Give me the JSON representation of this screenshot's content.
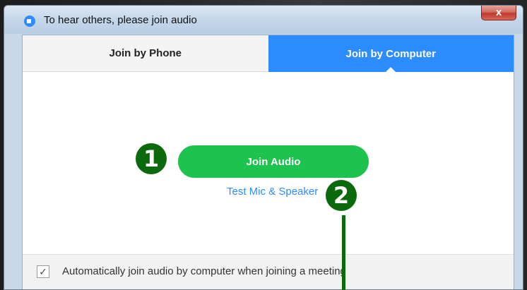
{
  "window": {
    "title": "To hear others, please join audio",
    "close_label": "x"
  },
  "tabs": [
    {
      "label": "Join by Phone",
      "active": false
    },
    {
      "label": "Join by Computer",
      "active": true
    }
  ],
  "main": {
    "join_audio_label": "Join Audio",
    "test_link_label": "Test Mic & Speaker"
  },
  "footer": {
    "checkbox_checked": true,
    "checkbox_glyph": "✓",
    "checkbox_label": "Automatically join audio by computer when joining a meeting"
  },
  "annotations": {
    "marker_1": "❶",
    "marker_2": "2"
  },
  "colors": {
    "accent_blue": "#2d8cff",
    "join_green": "#1dc24f",
    "annotation_green": "#0b6a0b"
  }
}
